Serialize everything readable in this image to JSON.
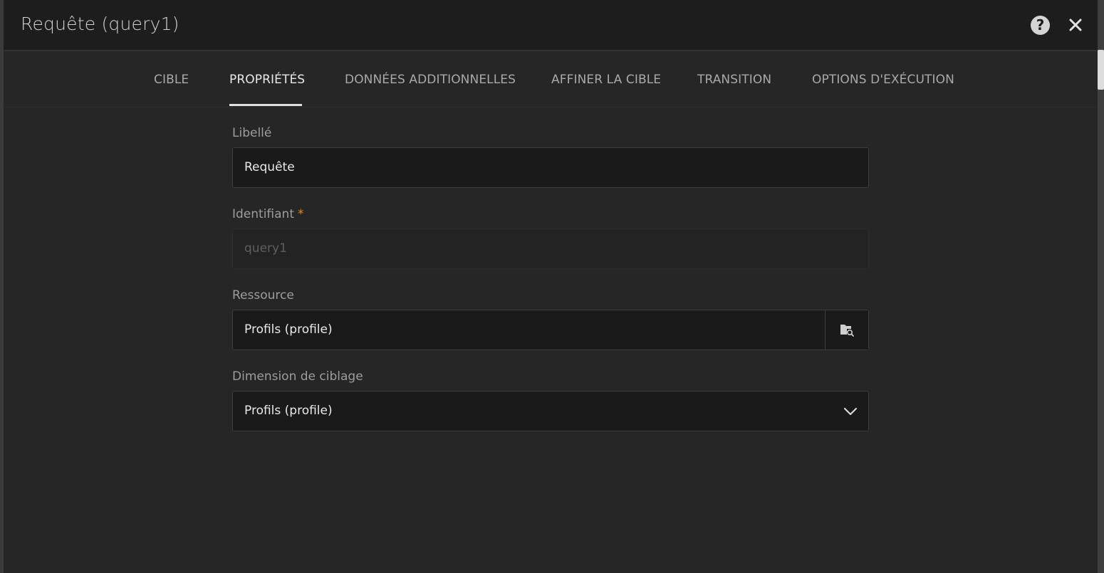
{
  "dialog": {
    "title": "Requête (query1)"
  },
  "tabs": [
    {
      "label": "CIBLE",
      "active": false
    },
    {
      "label": "PROPRIÉTÉS",
      "active": true
    },
    {
      "label": "DONNÉES ADDITIONNELLES",
      "active": false
    },
    {
      "label": "AFFINER LA CIBLE",
      "active": false
    },
    {
      "label": "TRANSITION",
      "active": false
    },
    {
      "label": "OPTIONS D'EXÉCUTION",
      "active": false
    }
  ],
  "form": {
    "label_field": {
      "label": "Libellé",
      "value": "Requête"
    },
    "identifier_field": {
      "label": "Identifiant",
      "required_mark": "*",
      "value": "query1",
      "disabled": true
    },
    "resource_field": {
      "label": "Ressource",
      "value": "Profils (profile)"
    },
    "targeting_dimension_field": {
      "label": "Dimension de ciblage",
      "value": "Profils (profile)"
    }
  },
  "icons": {
    "help": "help-circle-icon",
    "close": "close-icon",
    "resource_picker": "folder-search-icon",
    "dropdown": "chevron-down-icon"
  },
  "colors": {
    "background": "#262626",
    "titlebar": "#1d1d1d",
    "required": "#e68619"
  }
}
